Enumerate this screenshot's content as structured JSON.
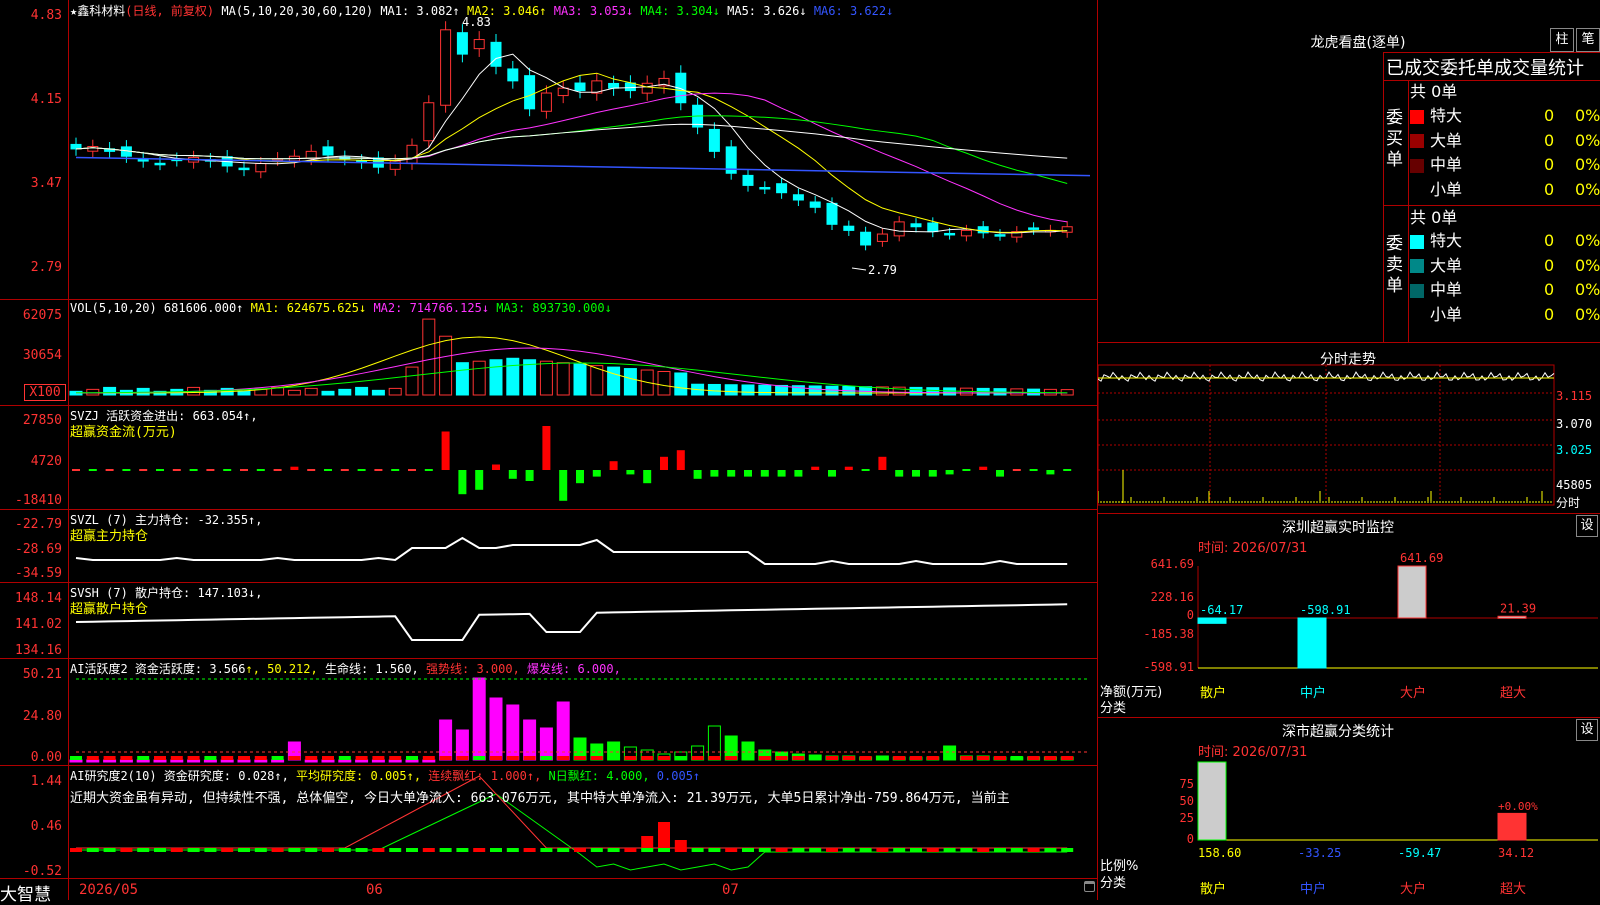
{
  "main_chart": {
    "title_parts": [
      {
        "text": "★鑫科材料",
        "color": "#ffffff"
      },
      {
        "text": "(日线, 前复权)",
        "color": "#ff3333"
      },
      {
        "text": " MA(5,10,20,30,60,120) ",
        "color": "#ffffff"
      },
      {
        "text": "MA1: 3.082↑",
        "color": "#ffffff"
      },
      {
        "text": " MA2: 3.046↑",
        "color": "#ffff00"
      },
      {
        "text": " MA3: 3.053↓",
        "color": "#ff33ff"
      },
      {
        "text": " MA4: 3.304↓",
        "color": "#00ff00"
      },
      {
        "text": " MA5: 3.626↓",
        "color": "#ffffff"
      },
      {
        "text": " MA6: 3.622↓",
        "color": "#3355ff"
      }
    ],
    "y_labels": [
      "4.83",
      "4.15",
      "3.47",
      "2.79"
    ],
    "high_label": "4.83",
    "low_label": "2.79"
  },
  "vol_panel": {
    "title_parts": [
      {
        "text": "VOL(5,10,20) 681606.000↑",
        "color": "#ffffff"
      },
      {
        "text": " MA1: 624675.625↓",
        "color": "#ffff00"
      },
      {
        "text": " MA2: 714766.125↓",
        "color": "#ff33ff"
      },
      {
        "text": " MA3: 893730.000↓",
        "color": "#00ff00"
      }
    ],
    "y_labels": [
      "62075",
      "30654",
      "X100"
    ]
  },
  "svzj_panel": {
    "title_line1": "SVZJ  活跃资金进出: 663.054↑,",
    "title_line2": "超赢资金流(万元)",
    "y_labels": [
      "27850",
      "4720",
      "-18410"
    ]
  },
  "svzl_panel": {
    "title_line1": "SVZL (7) 主力持仓: -32.355↑,",
    "title_line2": "超赢主力持仓",
    "y_labels": [
      "-22.79",
      "-28.69",
      "-34.59"
    ]
  },
  "svsh_panel": {
    "title_line1": "SVSH (7) 散户持仓: 147.103↓,",
    "title_line2": "超赢散户持仓",
    "y_labels": [
      "148.14",
      "141.02",
      "134.16"
    ]
  },
  "ai_active_panel": {
    "title_parts": [
      {
        "text": "AI活跃度2 资金活跃度: 3.566",
        "color": "#ffffff"
      },
      {
        "text": "↑, 50.212, ",
        "color": "#ffff00"
      },
      {
        "text": "生命线: 1.560, ",
        "color": "#ffffff"
      },
      {
        "text": "强势线: 3.000, ",
        "color": "#ff3333"
      },
      {
        "text": "爆发线: 6.000,",
        "color": "#ff33ff"
      }
    ],
    "y_labels": [
      "50.21",
      "24.80",
      "0.00"
    ]
  },
  "ai_research_panel": {
    "title_parts": [
      {
        "text": "AI研究度2(10) 资金研究度: 0.028↑, ",
        "color": "#ffffff"
      },
      {
        "text": "平均研究度: 0.005↑, ",
        "color": "#ffff00"
      },
      {
        "text": "连续飘红: 1.000↑, ",
        "color": "#ff3333"
      },
      {
        "text": "N日飘红: 4.000, ",
        "color": "#00ff00"
      },
      {
        "text": "0.005↑",
        "color": "#3355ff"
      }
    ],
    "summary": "近期大资金虽有异动, 但持续性不强, 总体偏空, 今日大单净流入: 663.076万元, 其中特大单净流入: 21.39万元, 大单5日累计净出-759.864万元, 当前主",
    "y_labels": [
      "1.44",
      "0.46",
      "-0.52"
    ]
  },
  "bottom_bar": {
    "brand": "大智慧",
    "dates": [
      "2026/05",
      "06",
      "07"
    ]
  },
  "longhu": {
    "title": "龙虎看盘(逐单)",
    "btn1": "柱",
    "btn2": "笔",
    "header": "已成交委托单成交量统计",
    "buy_label": "委买单",
    "sell_label": "委卖单",
    "buy_total": "共 0单",
    "sell_total": "共 0单",
    "buy_rows": [
      {
        "name": "特大",
        "count": "0",
        "pct": "0%",
        "color": "#ff0000"
      },
      {
        "name": "大单",
        "count": "0",
        "pct": "0%",
        "color": "#990000"
      },
      {
        "name": "中单",
        "count": "0",
        "pct": "0%",
        "color": "#660000"
      },
      {
        "name": "小单",
        "count": "0",
        "pct": "0%",
        "color": "#000000"
      }
    ],
    "sell_rows": [
      {
        "name": "特大",
        "count": "0",
        "pct": "0%",
        "color": "#00ffff"
      },
      {
        "name": "大单",
        "count": "0",
        "pct": "0%",
        "color": "#008888"
      },
      {
        "name": "中单",
        "count": "0",
        "pct": "0%",
        "color": "#006666"
      },
      {
        "name": "小单",
        "count": "0",
        "pct": "0%",
        "color": "#000000"
      }
    ]
  },
  "intraday": {
    "title": "分时走势",
    "y_labels": [
      "3.115",
      "3.070",
      "3.025",
      "45805",
      "分时"
    ]
  },
  "sz_monitor": {
    "title": "深圳超赢实时监控",
    "settings": "设",
    "time": "时间: 2026/07/31",
    "y_labels": [
      "641.69",
      "228.16",
      "0",
      "-185.38",
      "-598.91"
    ],
    "unit": "净额(万元)",
    "cat_label": "分类",
    "categories": [
      "散户",
      "中户",
      "大户",
      "超大"
    ],
    "chart_data": {
      "type": "bar",
      "categories": [
        "散户",
        "中户",
        "大户",
        "超大"
      ],
      "values": [
        -64.17,
        -598.91,
        641.69,
        21.39
      ],
      "value_labels": [
        "-64.17",
        "-598.91",
        "641.69",
        "21.39"
      ],
      "ylim": [
        -598.91,
        641.69
      ]
    }
  },
  "sz_class": {
    "title": "深市超赢分类统计",
    "settings": "设",
    "time": "时间: 2026/07/31",
    "y_labels": [
      "75",
      "50",
      "25",
      "0"
    ],
    "unit": "比例%",
    "cat_label": "分类",
    "categories": [
      "散户",
      "中户",
      "大户",
      "超大"
    ],
    "pct_label": "+0.00%",
    "chart_data": {
      "type": "bar",
      "categories": [
        "散户",
        "中户",
        "大户",
        "超大"
      ],
      "values": [
        158.6,
        -33.25,
        -59.47,
        34.12
      ],
      "value_labels": [
        "158.60",
        "-33.25",
        "-59.47",
        "34.12"
      ],
      "ylim": [
        0,
        100
      ]
    }
  },
  "colors": {
    "up": "#ff3333",
    "down": "#00ffff",
    "grid": "#b00000",
    "green": "#00ff00",
    "magenta": "#ff00ff",
    "yellow": "#ffff00"
  }
}
